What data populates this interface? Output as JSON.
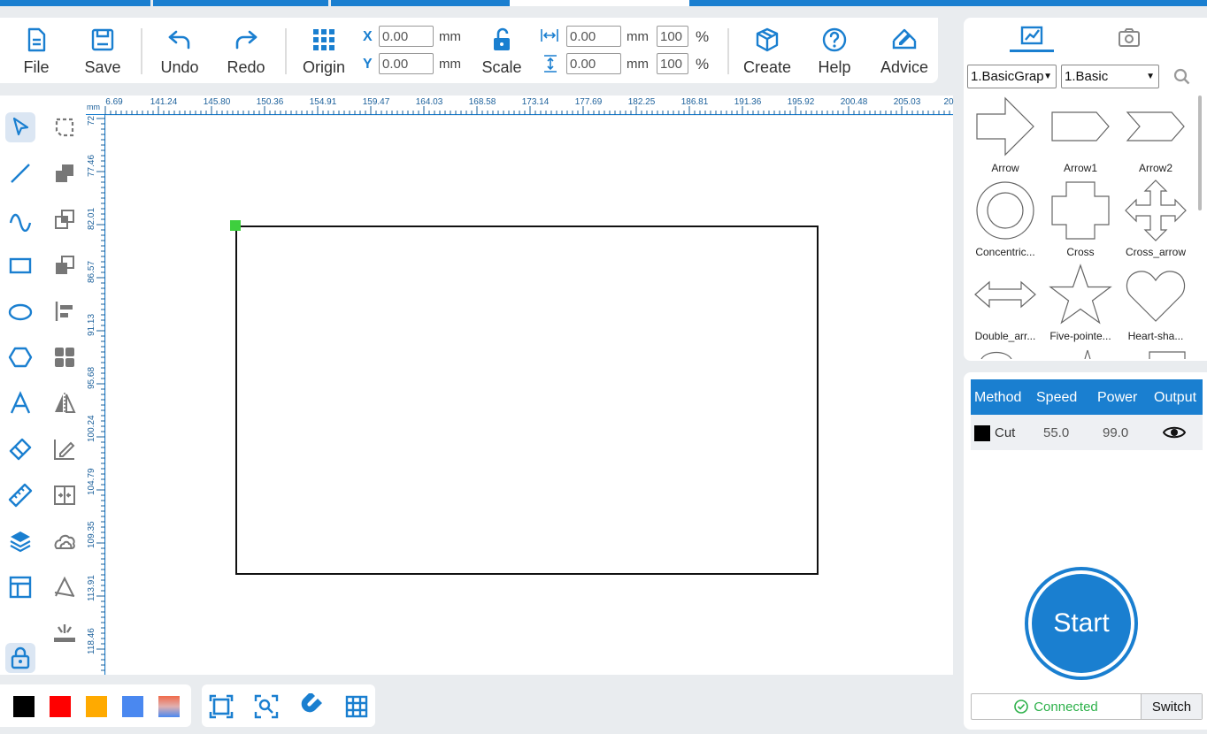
{
  "colors": {
    "accent": "#1a7fd0",
    "handle": "#3ecf3e",
    "connected": "#2db14a"
  },
  "toolbar": {
    "file_label": "File",
    "save_label": "Save",
    "undo_label": "Undo",
    "redo_label": "Redo",
    "origin_label": "Origin",
    "scale_label": "Scale",
    "create_label": "Create",
    "help_label": "Help",
    "advice_label": "Advice",
    "x_label": "X",
    "y_label": "Y",
    "x_value": "0.00",
    "y_value": "0.00",
    "width_value": "0.00",
    "height_value": "0.00",
    "width_pct": "100",
    "height_pct": "100",
    "unit_mm": "mm",
    "unit_pct": "%"
  },
  "left_tools": [
    {
      "name": "select-tool-icon",
      "active": true
    },
    {
      "name": "line-tool-icon"
    },
    {
      "name": "curve-tool-icon"
    },
    {
      "name": "rectangle-tool-icon"
    },
    {
      "name": "ellipse-tool-icon"
    },
    {
      "name": "polygon-tool-icon"
    },
    {
      "name": "text-tool-icon"
    },
    {
      "name": "eraser-tool-icon"
    },
    {
      "name": "ruler-tool-icon"
    },
    {
      "name": "layers-tool-icon"
    },
    {
      "name": "layout-tool-icon"
    },
    {
      "name": "lock-tool-icon",
      "active": true
    }
  ],
  "ruler": {
    "unit": "mm",
    "top_ticks": [
      "6.69",
      "141.24",
      "145.80",
      "150.36",
      "154.91",
      "159.47",
      "164.03",
      "168.58",
      "173.14",
      "177.69",
      "182.25",
      "186.81",
      "191.36",
      "195.92",
      "200.48",
      "205.03",
      "20"
    ],
    "left_ticks": [
      "72",
      "77.46",
      "82.01",
      "86.57",
      "91.13",
      "95.68",
      "100.24",
      "104.79",
      "109.35",
      "113.91",
      "118.46"
    ]
  },
  "color_swatches": [
    "#000000",
    "#ff0000",
    "#ffaa00",
    "#4a88f0",
    "gradient"
  ],
  "bottom_tools": [
    "fit-view-icon",
    "focus-selection-icon",
    "magnet-snap-icon",
    "grid-icon"
  ],
  "right_panel": {
    "tabs": [
      "shapes-tab-icon",
      "camera-tab-icon"
    ],
    "category_select": "1.BasicGrap",
    "subcategory_select": "1.Basic",
    "shapes": [
      {
        "name": "Arrow"
      },
      {
        "name": "Arrow1"
      },
      {
        "name": "Arrow2"
      },
      {
        "name": "Concentric..."
      },
      {
        "name": "Cross"
      },
      {
        "name": "Cross_arrow"
      },
      {
        "name": "Double_arr..."
      },
      {
        "name": "Five-pointe..."
      },
      {
        "name": "Heart-sha..."
      }
    ]
  },
  "layers": {
    "headers": {
      "method": "Method",
      "speed": "Speed",
      "power": "Power",
      "output": "Output"
    },
    "rows": [
      {
        "color": "#000000",
        "method": "Cut",
        "speed": "55.0",
        "power": "99.0"
      }
    ]
  },
  "start_label": "Start",
  "connection": {
    "status": "Connected",
    "switch_label": "Switch"
  }
}
